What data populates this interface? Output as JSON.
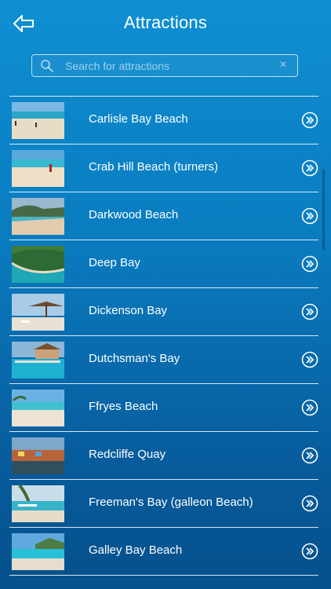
{
  "header": {
    "title": "Attractions"
  },
  "search": {
    "placeholder": "Search for attractions"
  },
  "attractions": [
    {
      "name": "Carlisle Bay Beach"
    },
    {
      "name": "Crab Hill Beach (turners)"
    },
    {
      "name": "Darkwood Beach"
    },
    {
      "name": "Deep Bay"
    },
    {
      "name": "Dickenson Bay"
    },
    {
      "name": "Dutchsman's Bay"
    },
    {
      "name": "Ffryes Beach"
    },
    {
      "name": "Redcliffe Quay"
    },
    {
      "name": "Freeman's Bay (galleon Beach)"
    },
    {
      "name": "Galley Bay Beach"
    }
  ],
  "icons": {
    "back": "back-arrow-icon",
    "search": "search-icon",
    "clear": "clear-icon",
    "row": "chevron-right-circle-icon"
  },
  "colors": {
    "background_top": "#0f8fd2",
    "background_bottom": "#06508c",
    "text": "#ffffff"
  }
}
